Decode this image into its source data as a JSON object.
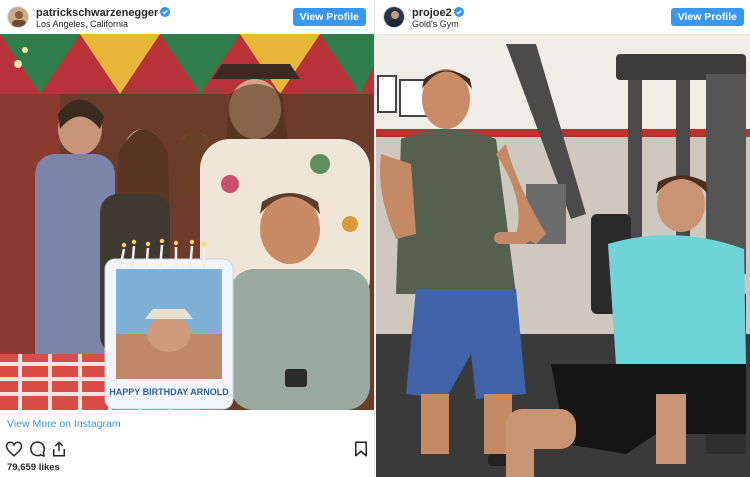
{
  "posts": [
    {
      "username": "patrickschwarzenegger",
      "location": "Los Angeles, California",
      "view_profile_label": "View Profile",
      "cake_text": "HAPPY BIRTHDAY ARNOLD",
      "view_more_label": "View More on Instagram",
      "likes_label": "79,659 likes",
      "icons": [
        "heart-icon",
        "comment-icon",
        "share-icon",
        "bookmark-icon",
        "verified-badge-icon"
      ]
    },
    {
      "username": "projoe2",
      "location": "Gold's Gym",
      "view_profile_label": "View Profile",
      "icons": [
        "verified-badge-icon"
      ]
    }
  ],
  "colors": {
    "button_blue": "#3897f0",
    "link_blue": "#3897f0",
    "verified_blue": "#3897f0",
    "text_dark": "#262626"
  }
}
